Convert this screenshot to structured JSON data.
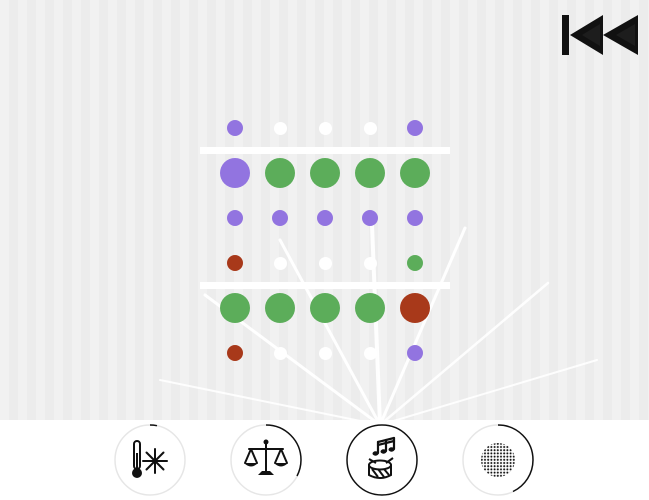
{
  "game": {
    "board": {
      "rows": [
        [
          "purple",
          "white",
          "white",
          "white",
          "purple"
        ],
        [
          "purple",
          "green",
          "green",
          "green",
          "green"
        ],
        [
          "purple",
          "purple",
          "purple",
          "purple",
          "purple"
        ],
        [
          "red",
          "white",
          "white",
          "white",
          "green"
        ],
        [
          "green",
          "green",
          "green",
          "green",
          "red"
        ],
        [
          "red",
          "white",
          "white",
          "white",
          "purple"
        ]
      ],
      "large_rows": [
        1,
        4
      ],
      "separators_after_rows": [
        0,
        3
      ]
    },
    "colors": {
      "purple": "#9274e0",
      "green": "#5cad5a",
      "red": "#a8391a",
      "white": "#ffffff",
      "background": "#efefef",
      "icon": "#111111"
    },
    "controls": {
      "rewind_icon": "rewind-to-start-icon"
    },
    "toolbar": {
      "selected_index": 2,
      "tools": [
        {
          "icon": "thermometer-snowflake-icon",
          "selected": false
        },
        {
          "icon": "balance-scale-icon",
          "selected": false
        },
        {
          "icon": "music-drum-icon",
          "selected": true
        },
        {
          "icon": "dotted-circle-icon",
          "selected": false
        }
      ]
    }
  }
}
